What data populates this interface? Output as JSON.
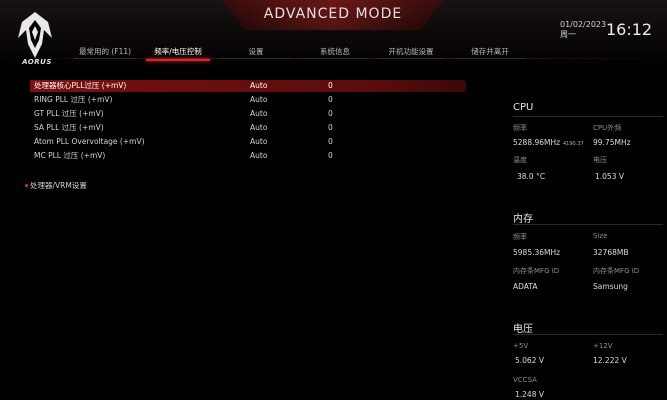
{
  "header": {
    "title": "ADVANCED MODE",
    "logo_text": "AORUS",
    "date_line1": "01/02/2023",
    "date_line2": "周一",
    "time": "16:12"
  },
  "tabs": [
    {
      "label": "最常用的 (F11)",
      "active": false
    },
    {
      "label": "频率/电压控制",
      "active": true
    },
    {
      "label": "设置",
      "active": false
    },
    {
      "label": "系统信息",
      "active": false
    },
    {
      "label": "开机功能设置",
      "active": false
    },
    {
      "label": "储存并离开",
      "active": false
    }
  ],
  "settings": [
    {
      "label": "处理器核心PLL过压 (+mV)",
      "value": "Auto",
      "num": "0",
      "selected": true
    },
    {
      "label": "RING PLL 过压 (+mV)",
      "value": "Auto",
      "num": "0",
      "selected": false
    },
    {
      "label": "GT PLL 过压 (+mV)",
      "value": "Auto",
      "num": "0",
      "selected": false
    },
    {
      "label": "SA PLL 过压 (+mV)",
      "value": "Auto",
      "num": "0",
      "selected": false
    },
    {
      "label": "Atom PLL Overvoltage (+mV)",
      "value": "Auto",
      "num": "0",
      "selected": false
    },
    {
      "label": "MC PLL 过压 (+mV)",
      "value": "Auto",
      "num": "0",
      "selected": false
    }
  ],
  "submenu": {
    "label": "处理器/VRM设置"
  },
  "sysinfo": {
    "cpu": {
      "title": "CPU",
      "freq_label": "频率",
      "freq_value": "5288.96MHz",
      "freq_small": "4190.37",
      "ext_label": "CPU外频",
      "ext_value": "99.75MHz",
      "temp_label": "温度",
      "temp_value": "38.0 °C",
      "volt_label": "电压",
      "volt_value": "1.053 V"
    },
    "memory": {
      "title": "内存",
      "freq_label": "频率",
      "freq_value": "5985.36MHz",
      "size_label": "Size",
      "size_value": "32768MB",
      "ch_a_label": "内存条MFG ID",
      "ch_a_value": "ADATA",
      "ch_b_label": "内存条MFG ID",
      "ch_b_value": "Samsung"
    },
    "voltage": {
      "title": "电压",
      "v5_label": "+5V",
      "v5_value": "5.062 V",
      "v12_label": "+12V",
      "v12_value": "12.222 V",
      "vccsa_label": "VCCSA",
      "vccsa_value": "1.248 V"
    }
  },
  "colors": {
    "accent": "#d02828",
    "selected_row": "#7a1010",
    "background": "#000000"
  }
}
